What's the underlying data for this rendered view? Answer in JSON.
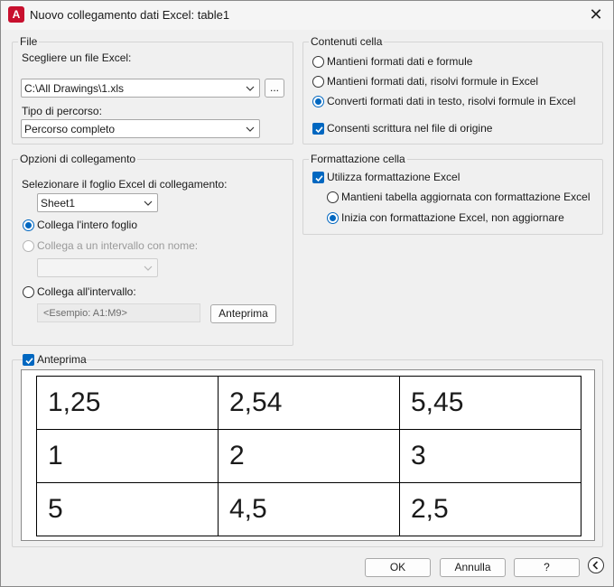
{
  "window": {
    "title": "Nuovo collegamento dati Excel: table1",
    "app_icon_letter": "A"
  },
  "file_group": {
    "label": "File",
    "choose_label": "Scegliere un file Excel:",
    "file_value": "C:\\All Drawings\\1.xls",
    "browse_label": "...",
    "path_type_label": "Tipo di percorso:",
    "path_type_value": "Percorso completo"
  },
  "link_options": {
    "label": "Opzioni di collegamento",
    "sheet_label": "Selezionare il foglio Excel di collegamento:",
    "sheet_value": "Sheet1",
    "radio_entire": "Collega l'intero foglio",
    "radio_named": "Collega a un intervallo con nome:",
    "radio_range": "Collega all'intervallo:",
    "range_placeholder": "<Esempio: A1:M9>",
    "preview_button": "Anteprima"
  },
  "cell_contents": {
    "label": "Contenuti cella",
    "opt1": "Mantieni formati dati e formule",
    "opt2": "Mantieni formati dati, risolvi formule in Excel",
    "opt3": "Converti formati dati in testo, risolvi formule in Excel",
    "allow_write": "Consenti scrittura nel file di origine"
  },
  "cell_formatting": {
    "label": "Formattazione cella",
    "use_excel": "Utilizza formattazione Excel",
    "opt_keep": "Mantieni tabella aggiornata con formattazione Excel",
    "opt_start": "Inizia con formattazione Excel, non aggiornare"
  },
  "preview": {
    "label": "Anteprima",
    "rows": [
      [
        "1,25",
        "2,54",
        "5,45"
      ],
      [
        "1",
        "2",
        "3"
      ],
      [
        "5",
        "4,5",
        "2,5"
      ]
    ]
  },
  "footer": {
    "ok": "OK",
    "cancel": "Annulla",
    "help": "?"
  },
  "colors": {
    "accent": "#0067c0",
    "app_icon": "#c8102e"
  }
}
